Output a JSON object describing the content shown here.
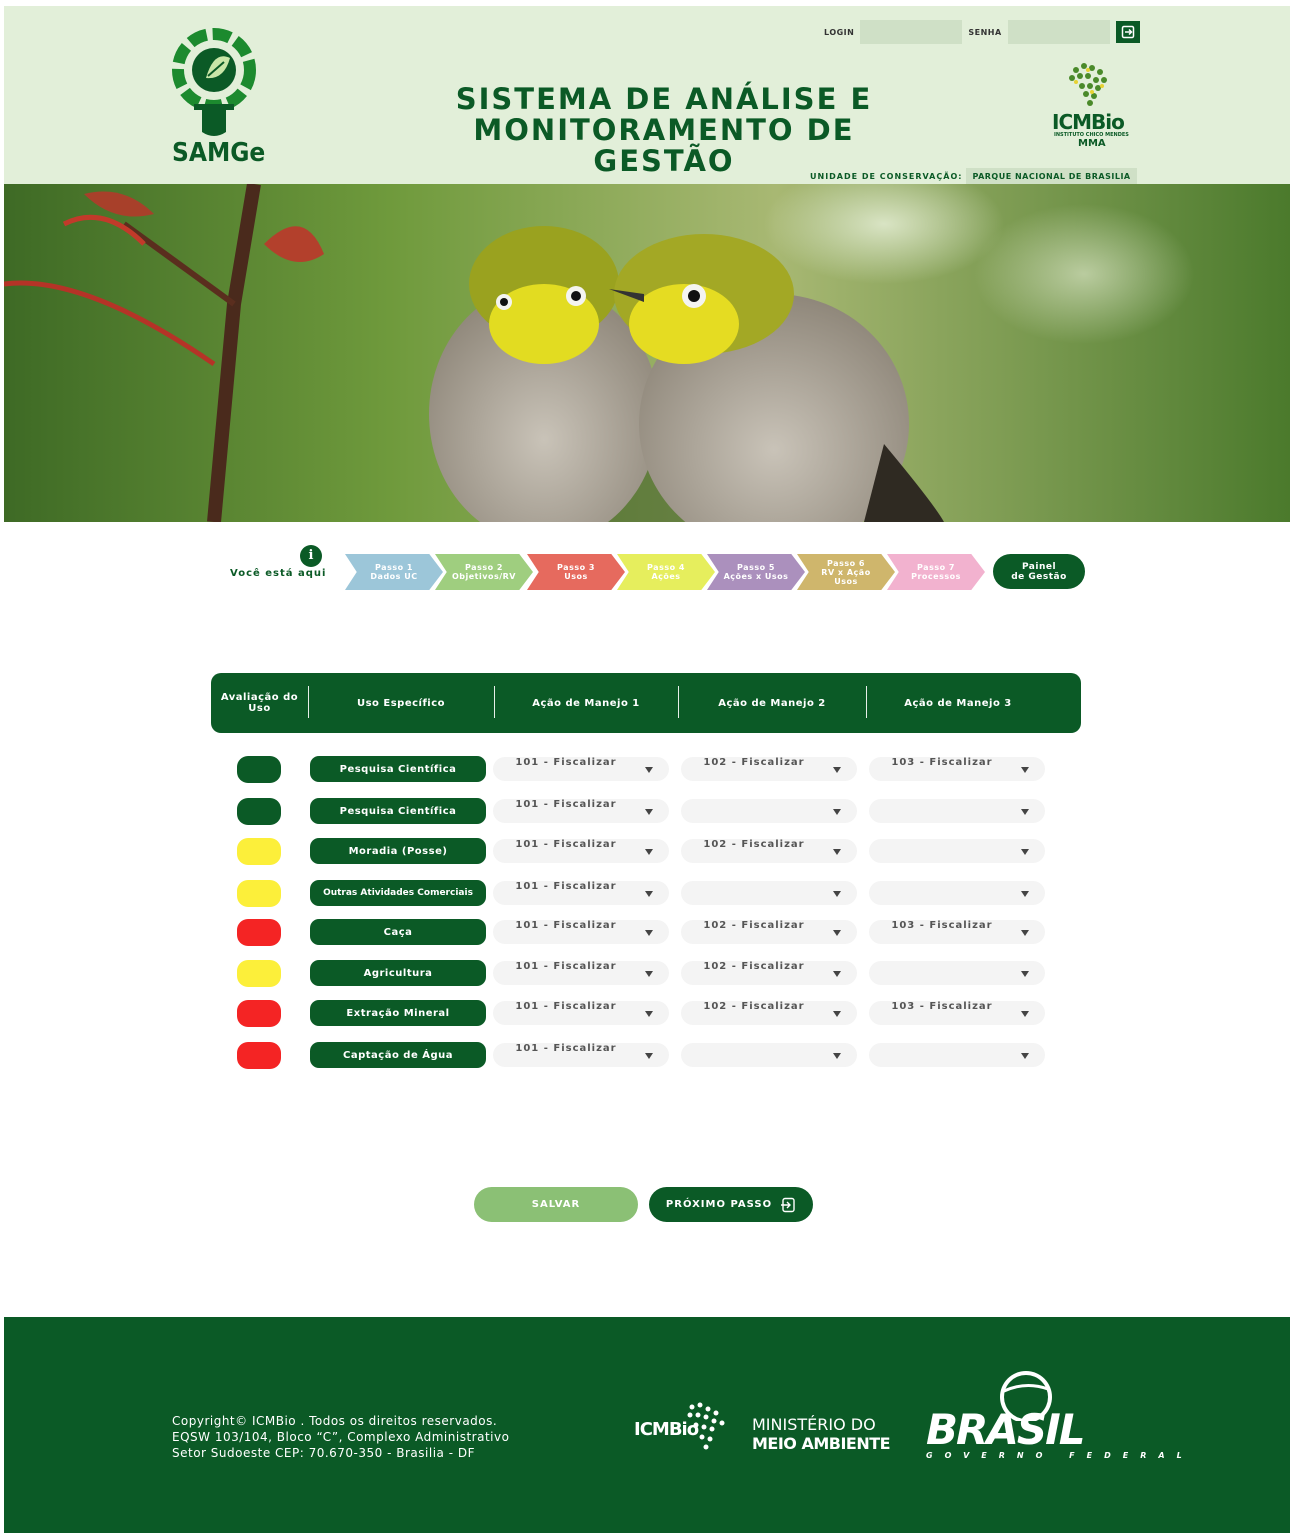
{
  "header": {
    "login_label": "LOGIN",
    "senha_label": "SENHA",
    "title_line1": "SISTEMA DE ANÁLISE E",
    "title_line2": "MONITORAMENTO DE GESTÃO",
    "samge_logo_text": "SAMGe",
    "icmbio_logo_text": "ICMBio",
    "icmbio_sub": "INSTITUTO CHICO MENDES",
    "icmbio_mma": "MMA",
    "unidade_label": "UNIDADE DE CONSERVAÇÃO:",
    "unidade_value": "PARQUE NACIONAL DE BRASILIA"
  },
  "steps": {
    "voce_esta_aqui": "Você está aqui",
    "info_glyph": "i",
    "items": [
      {
        "l1": "Passo 1",
        "l2": "Dados UC",
        "l3": "",
        "color": "#9cc6d9"
      },
      {
        "l1": "Passo 2",
        "l2": "Objetivos/RV",
        "l3": "",
        "color": "#9fce7f"
      },
      {
        "l1": "Passo 3",
        "l2": "Usos",
        "l3": "",
        "color": "#e66a5e"
      },
      {
        "l1": "Passo 4",
        "l2": "Ações",
        "l3": "",
        "color": "#e6ee5d"
      },
      {
        "l1": "Passo 5",
        "l2": "Ações x Usos",
        "l3": "",
        "color": "#ab90bd"
      },
      {
        "l1": "Passo 6",
        "l2": "RV x Ação",
        "l3": "Usos",
        "color": "#cfb66c"
      },
      {
        "l1": "Passo 7",
        "l2": "Processos",
        "l3": "",
        "color": "#f2b2cf"
      }
    ],
    "painel_l1": "Painel",
    "painel_l2": "de Gestão"
  },
  "table": {
    "headers": [
      "Avaliação do Uso",
      "Uso Específico",
      "Ação de Manejo 1",
      "Ação de Manejo 2",
      "Ação de Manejo 3"
    ],
    "rows": [
      {
        "status": "#0b5a26",
        "uso": "Pesquisa Científica",
        "a1": "101 - Fiscalizar",
        "a2": "102 - Fiscalizar",
        "a3": "103 - Fiscalizar"
      },
      {
        "status": "#0b5a26",
        "uso": "Pesquisa Científica",
        "a1": "101 - Fiscalizar",
        "a2": "",
        "a3": ""
      },
      {
        "status": "#fcef3a",
        "uso": "Moradia (Posse)",
        "a1": "101 - Fiscalizar",
        "a2": "102 - Fiscalizar",
        "a3": ""
      },
      {
        "status": "#fcef3a",
        "uso": "Outras Atividades Comerciais",
        "a1": "101 - Fiscalizar",
        "a2": "",
        "a3": ""
      },
      {
        "status": "#f42424",
        "uso": "Caça",
        "a1": "101 - Fiscalizar",
        "a2": "102 - Fiscalizar",
        "a3": "103 - Fiscalizar"
      },
      {
        "status": "#fcef3a",
        "uso": "Agricultura",
        "a1": "101 - Fiscalizar",
        "a2": "102 - Fiscalizar",
        "a3": ""
      },
      {
        "status": "#f42424",
        "uso": "Extração Mineral",
        "a1": "101 - Fiscalizar",
        "a2": "102 - Fiscalizar",
        "a3": "103 - Fiscalizar"
      },
      {
        "status": "#f42424",
        "uso": "Captação de Água",
        "a1": "101 - Fiscalizar",
        "a2": "",
        "a3": ""
      }
    ]
  },
  "buttons": {
    "salvar": "SALVAR",
    "proximo": "PRÓXIMO PASSO"
  },
  "footer": {
    "line1": "Copyright© ICMBio . Todos os direitos reservados.",
    "line2": "EQSW 103/104, Bloco “C”, Complexo Administrativo",
    "line3": "Setor Sudoeste CEP: 70.670-350 - Brasilia - DF",
    "icmbio": "ICMBio",
    "mma_l1": "MINISTÉRIO DO",
    "mma_l2": "MEIO AMBIENTE",
    "brasil": "BRASIL",
    "gov": "GOVERNO FEDERAL"
  },
  "colors": {
    "brand_green": "#0b5a26",
    "header_bg": "#e2efd9",
    "salvar_bg": "#8bc075"
  }
}
